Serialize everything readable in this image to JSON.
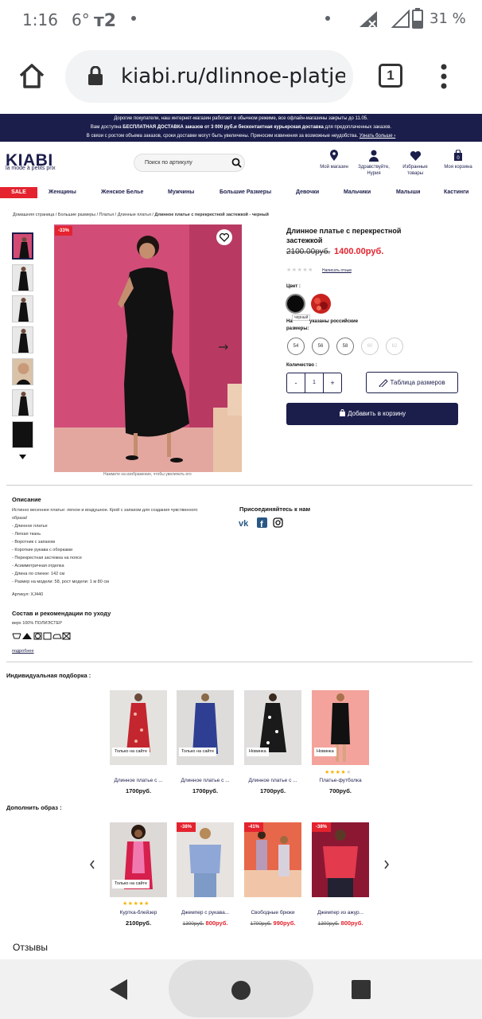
{
  "status_bar": {
    "time": "1:16",
    "temp": "6°",
    "battery": "31 %"
  },
  "browser": {
    "url": "kiabi.ru/dlinnoe-platje-s",
    "tab_count": "1"
  },
  "banner": {
    "line1": "Дорогие покупатели, наш интернет-магазин работает в обычном режиме, все офлайн-магазины закрыты до 11.05.",
    "line2a": "Вам доступна ",
    "line2b": "БЕСПЛАТНАЯ ДОСТАВКА заказов от 3 000 руб.и бесконтактная курьерская доставка",
    "line2c": " для предоплаченных заказов.",
    "line3": "В связи с ростом объема заказов, сроки доставки могут быть увеличены. Приносим извинения за возможные неудобства.",
    "line3link": "Узнать больше ›"
  },
  "header": {
    "logo": "KIABI",
    "tagline": "la mode à petits prix",
    "search_placeholder": "Поиск по артикулу",
    "my_store": "Мой магазин",
    "user": "Здравствуйте, Нурия",
    "favorites": "Избранные товары",
    "cart": "Моя корзина",
    "cart_count": "0"
  },
  "nav": {
    "sale": "SALE",
    "items": [
      "Женщины",
      "Женское Белье",
      "Мужчины",
      "Большие Размеры",
      "Девочки",
      "Мальчики",
      "Малыши",
      "Кастинги"
    ]
  },
  "breadcrumb": {
    "items": [
      "Домашняя страница",
      "Большие размеры",
      "Платья",
      "Длинные платья"
    ],
    "current": "Длинное платье с перекрестной застежкой - черный"
  },
  "product": {
    "discount": "-33%",
    "zoom_hint": "Нажмите на изображение, чтобы увеличить его",
    "title": "Длинное платье с перекрестной застежкой",
    "old_price": "2100.00руб.",
    "new_price": "1400.00руб.",
    "rating": 0,
    "review_link": "Написать отзыв",
    "color_label": "Цвет :",
    "color_tooltip": "черный",
    "size_label_1": "На",
    "size_label_2": "указаны российские",
    "size_label_3": "размеры:",
    "sizes": [
      {
        "label": "54",
        "available": true
      },
      {
        "label": "56",
        "available": true
      },
      {
        "label": "58",
        "available": true
      },
      {
        "label": "60",
        "available": false
      },
      {
        "label": "62",
        "available": false
      }
    ],
    "qty_label": "Количество :",
    "qty_minus": "-",
    "qty_value": "1",
    "qty_plus": "+",
    "size_table": "Таблица размеров",
    "add_to_cart": "Добавить в корзину"
  },
  "description": {
    "heading": "Описание",
    "lines": [
      "Истинно весеннее платье: легкое и воздушное. Крой с запахом для создания чувственного",
      "образа!",
      "- Длинное платье",
      "- Легкая ткань",
      "- Воротник с запахом",
      "- Короткие рукава с оборками",
      "- Перекрестная застежка на поясе",
      "- Асимметричная отделка",
      "- Длина по спинке: 142 см",
      "- Размер на модели: 58, рост модели: 1 м 80 см"
    ],
    "article": "Артикул: XJ440",
    "care_heading": "Состав и рекомендации по уходу",
    "composition": "верх 100% ПОЛИЭСТЕР",
    "more": "подробнее",
    "social_heading": "Присоединяйтесь к нам"
  },
  "recommend": {
    "heading": "Индивидуальная подборка :",
    "items": [
      {
        "badge": "Только на сайте",
        "name": "Длинное платье с ...",
        "price": "1700руб.",
        "rating": 0
      },
      {
        "badge": "Только на сайте",
        "name": "Длинное платье с ...",
        "price": "1700руб.",
        "rating": 0
      },
      {
        "badge": "Новинка",
        "name": "Длинное платье с ...",
        "price": "1700руб.",
        "rating": 0
      },
      {
        "badge": "Новинка",
        "name": "Платье-футболка",
        "price": "700руб.",
        "rating": 4
      }
    ]
  },
  "complete": {
    "heading": "Дополнить образ :",
    "items": [
      {
        "discount": "",
        "badge": "Только на сайте",
        "name": "Куртка-блейзер",
        "old": "",
        "price": "2100руб.",
        "rating": 5
      },
      {
        "discount": "-38%",
        "badge": "",
        "name": "Джемпер с рукава...",
        "old": "1300руб.",
        "price": "800руб.",
        "rating": 0
      },
      {
        "discount": "-41%",
        "badge": "",
        "name": "Свободные брюки",
        "old": "1700руб.",
        "price": "990руб.",
        "rating": 0
      },
      {
        "discount": "-38%",
        "badge": "",
        "name": "Джемпер из ажур...",
        "old": "1300руб.",
        "price": "800руб.",
        "rating": 0
      }
    ]
  },
  "reviews_heading": "Отзывы"
}
